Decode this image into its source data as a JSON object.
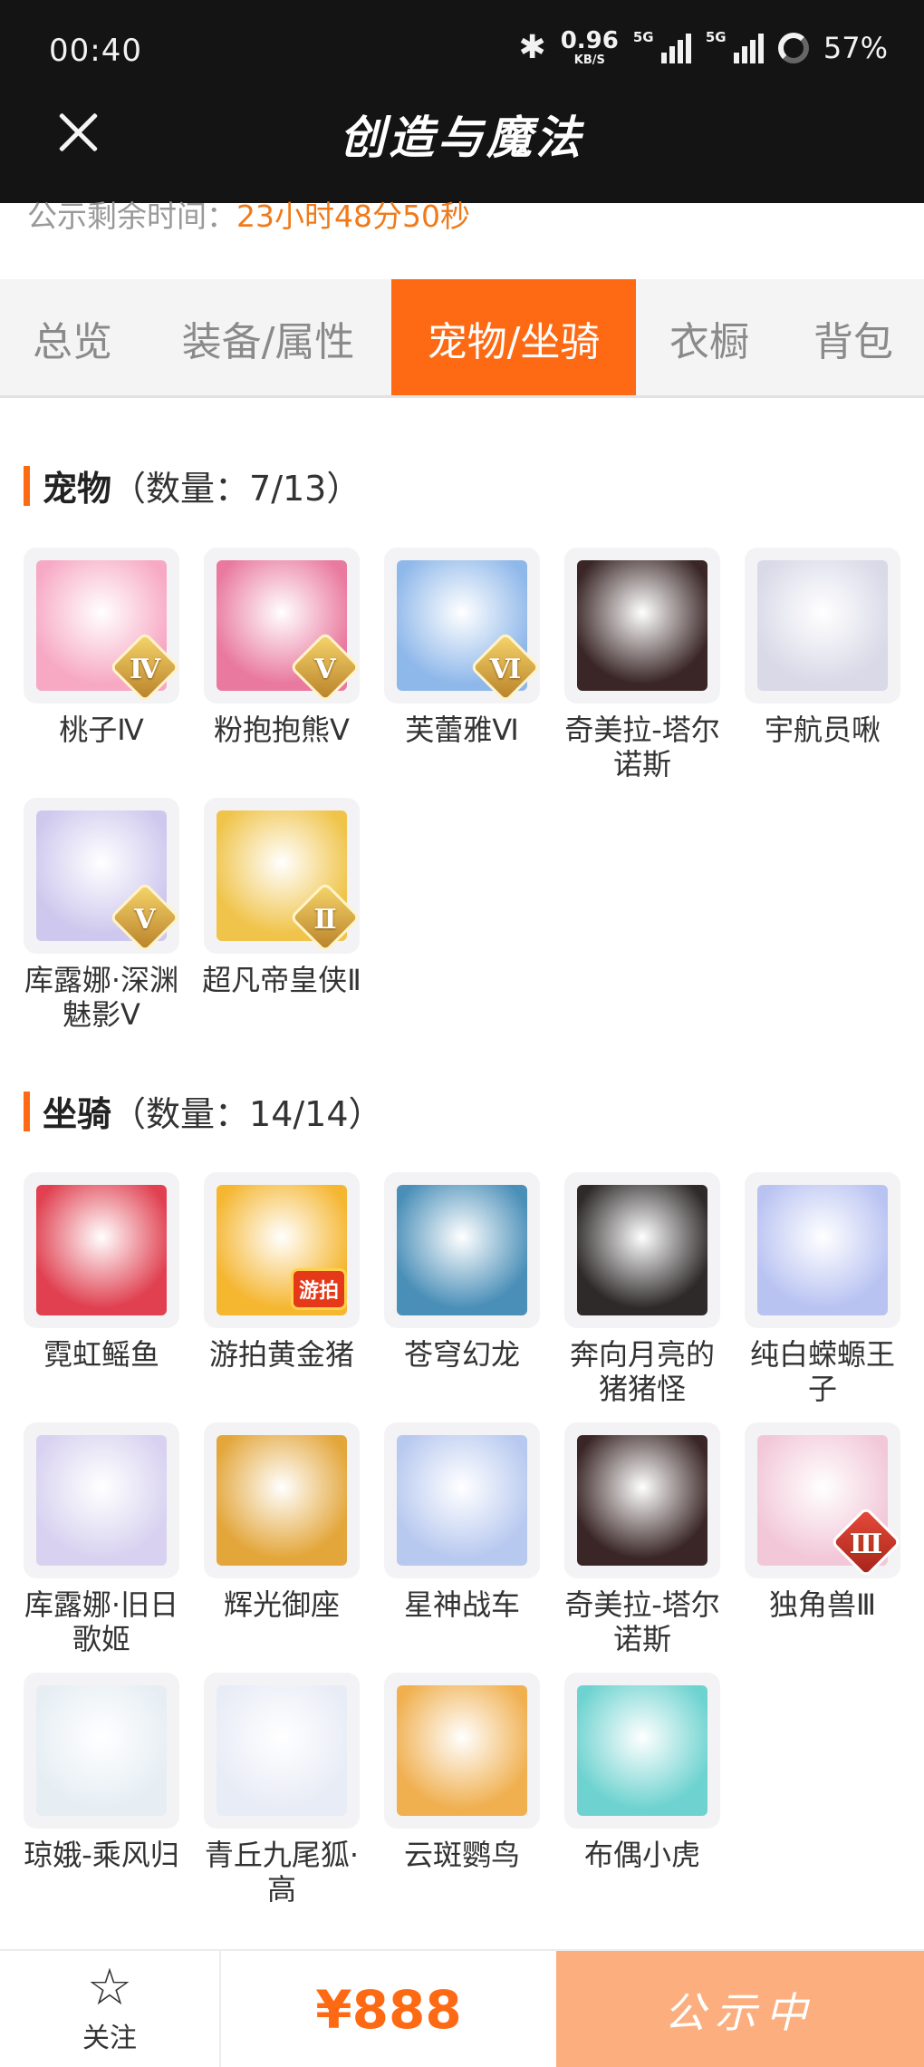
{
  "status_bar": {
    "time": "00:40",
    "net_speed": "0.96",
    "net_unit": "KB/S",
    "signal1": "5G",
    "signal2": "5G",
    "battery": "57%"
  },
  "header": {
    "title": "创造与魔法"
  },
  "notice": {
    "label": "公示剩余时间：",
    "countdown": "23小时48分50秒"
  },
  "tabs": [
    {
      "label": "总览"
    },
    {
      "label": "装备/属性"
    },
    {
      "label": "宠物/坐骑"
    },
    {
      "label": "衣橱"
    },
    {
      "label": "背包"
    }
  ],
  "active_tab": "宠物/坐骑",
  "pets": {
    "title": "宠物",
    "count": "（数量：7/13）",
    "items": [
      {
        "name": "桃子Ⅳ",
        "badge": "Ⅳ",
        "icon": "pink-bunny-pet",
        "color": "#f7a9c4"
      },
      {
        "name": "粉抱抱熊Ⅴ",
        "badge": "Ⅴ",
        "icon": "pink-bear-pet",
        "color": "#e9799e"
      },
      {
        "name": "芙蕾雅Ⅵ",
        "badge": "Ⅵ",
        "icon": "valkyrie-pet",
        "color": "#8fb8ea"
      },
      {
        "name": "奇美拉-塔尔诺斯",
        "badge": "",
        "icon": "chimera-pet",
        "color": "#3a2626"
      },
      {
        "name": "宇航员啾",
        "badge": "",
        "icon": "astronaut-pet",
        "color": "#d9d9e8"
      },
      {
        "name": "库露娜·深渊魅影Ⅴ",
        "badge": "Ⅴ",
        "icon": "kuluna-abyss-pet",
        "color": "#cfc8ee"
      },
      {
        "name": "超凡帝皇侠Ⅱ",
        "badge": "Ⅱ",
        "icon": "golden-knight-pet",
        "color": "#f0c44a"
      }
    ]
  },
  "mounts": {
    "title": "坐骑",
    "count": "（数量：14/14）",
    "items": [
      {
        "name": "霓虹鳐鱼",
        "icon": "neon-ray-mount",
        "color": "#e04050"
      },
      {
        "name": "游拍黄金猪",
        "icon": "golden-pig-mount",
        "color": "#f5b630",
        "tag": "游拍"
      },
      {
        "name": "苍穹幻龙",
        "icon": "sky-dragon-mount",
        "color": "#4a8fb8"
      },
      {
        "name": "奔向月亮的猪猪怪",
        "icon": "moon-pig-mount",
        "color": "#2e2a2a"
      },
      {
        "name": "纯白蝾螈王子",
        "icon": "white-salamander-mount",
        "color": "#b9c3f2"
      },
      {
        "name": "库露娜·旧日歌姬",
        "icon": "kuluna-diva-mount",
        "color": "#d8d2f0"
      },
      {
        "name": "辉光御座",
        "icon": "radiant-throne-mount",
        "color": "#e3a63a"
      },
      {
        "name": "星神战车",
        "icon": "star-chariot-mount",
        "color": "#b8c9f0"
      },
      {
        "name": "奇美拉-塔尔诺斯",
        "icon": "chimera-mount",
        "color": "#3a2626"
      },
      {
        "name": "独角兽Ⅲ",
        "icon": "unicorn-mount",
        "color": "#f2c8d8",
        "badge": "Ⅲ"
      },
      {
        "name": "琼娥-乘风归",
        "icon": "qiong-e-mount",
        "color": "#e6eef4"
      },
      {
        "name": "青丘九尾狐·高",
        "icon": "nine-tail-fox-mount",
        "color": "#e8ecf6"
      },
      {
        "name": "云斑鹦鸟",
        "icon": "parrot-mount",
        "color": "#f0b050"
      },
      {
        "name": "布偶小虎",
        "icon": "puppet-tiger-mount",
        "color": "#6ed3d0"
      }
    ]
  },
  "bottom": {
    "follow_label": "关注",
    "price": "¥888",
    "status_label": "公示中"
  }
}
